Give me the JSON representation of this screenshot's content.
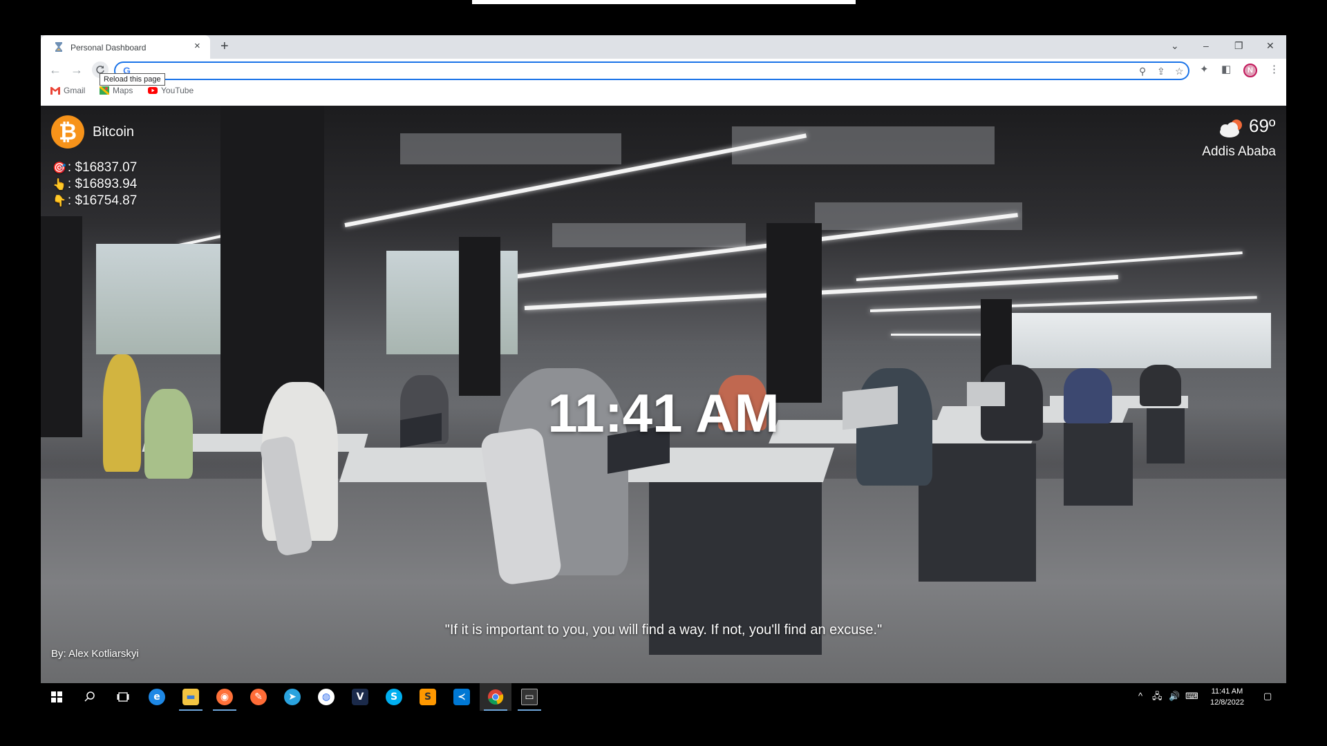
{
  "browser": {
    "tab_title": "Personal Dashboard",
    "tab_close": "×",
    "new_tab": "+",
    "window_controls": {
      "tab_search": "⌄",
      "minimize": "–",
      "restore": "❐",
      "close": "✕"
    },
    "nav": {
      "back": "←",
      "forward": "→"
    },
    "tooltip": "Reload this page",
    "omnibox_value": "",
    "bookmarks": [
      {
        "label": "Gmail",
        "color": "#ea4335"
      },
      {
        "label": "Maps",
        "color": "#34a853"
      },
      {
        "label": "YouTube",
        "color": "#ff0000"
      }
    ],
    "profile_initial": "N"
  },
  "dashboard": {
    "coin": {
      "name": "Bitcoin",
      "symbol": "₿",
      "color": "#f7931a"
    },
    "prices": [
      {
        "emoji": "🎯",
        "label": ": $16837.07"
      },
      {
        "emoji": "👆",
        "label": ": $16893.94"
      },
      {
        "emoji": "👇",
        "label": ": $16754.87"
      }
    ],
    "weather": {
      "temp": "69º",
      "city": "Addis Ababa"
    },
    "time": "11:41 AM",
    "quote": "\"If it is important to you, you will find a way. If not, you'll find an excuse.\"",
    "credit": "By: Alex Kotliarskyi"
  },
  "taskbar": {
    "apps": [
      {
        "name": "windows-start",
        "glyph": "⊞",
        "bg": "transparent"
      },
      {
        "name": "search",
        "glyph": "⌕",
        "bg": "transparent"
      },
      {
        "name": "task-view",
        "glyph": "❒",
        "bg": "transparent"
      },
      {
        "name": "internet-explorer",
        "glyph": "e",
        "bg": "#1e88e5"
      },
      {
        "name": "file-explorer",
        "glyph": "▬",
        "bg": "#f4c542"
      },
      {
        "name": "firefox",
        "glyph": "◉",
        "bg": "#ff7139"
      },
      {
        "name": "postman",
        "glyph": "✎",
        "bg": "#ff6c37"
      },
      {
        "name": "telegram",
        "glyph": "➤",
        "bg": "#2aa3df"
      },
      {
        "name": "signal",
        "glyph": "◍",
        "bg": "#ffffff"
      },
      {
        "name": "vivaldi",
        "glyph": "V",
        "bg": "#1b2a4a"
      },
      {
        "name": "skype",
        "glyph": "S",
        "bg": "#00aff0"
      },
      {
        "name": "sublime-text",
        "glyph": "S",
        "bg": "#ff9800"
      },
      {
        "name": "vscode",
        "glyph": "≺",
        "bg": "#0078d4"
      },
      {
        "name": "chrome",
        "glyph": "◎",
        "bg": "#e53935"
      },
      {
        "name": "terminal",
        "glyph": "▭",
        "bg": "#333333"
      }
    ],
    "tray": {
      "chevron": "^",
      "network": "🖧",
      "volume": "🔊",
      "keyboard": "⌨",
      "notifications": "▢"
    },
    "clock_time": "11:41 AM",
    "clock_date": "12/8/2022"
  }
}
